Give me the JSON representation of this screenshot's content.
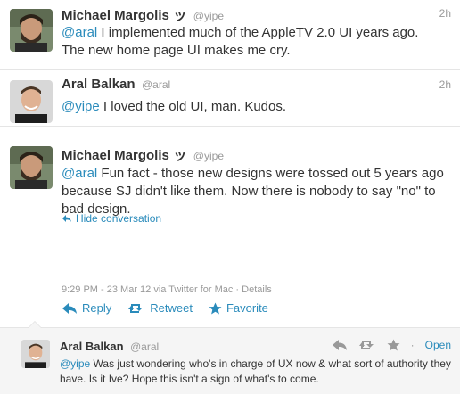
{
  "tweets": [
    {
      "name": "Michael Margolis",
      "badge": "ッ",
      "handle": "@yipe",
      "time": "2h",
      "mention": "@aral",
      "text": " I implemented much of the AppleTV 2.0 UI years ago. The new home page UI makes me cry."
    },
    {
      "name": "Aral Balkan",
      "handle": "@aral",
      "time": "2h",
      "mention": "@yipe",
      "text": " I loved the old UI, man. Kudos."
    },
    {
      "name": "Michael Margolis",
      "badge": "ッ",
      "handle": "@yipe",
      "mention": "@aral",
      "text": " Fun fact - those new designs were tossed out 5 years ago because SJ didn't like them. Now there is nobody to say \"no\" to bad design.",
      "hide_conversation": "Hide conversation",
      "meta": "9:29 PM - 23 Mar 12 via Twitter for Mac · Details",
      "actions": {
        "reply": "Reply",
        "retweet": "Retweet",
        "favorite": "Favorite"
      }
    },
    {
      "name": "Aral Balkan",
      "handle": "@aral",
      "mention": "@yipe",
      "text": " Was just wondering who's in charge of UX now & what sort of authority they have. Is it Ive? Hope this isn't a sign of what's to come.",
      "open": "Open",
      "separator": "·"
    }
  ],
  "colors": {
    "link": "#2a8bbb",
    "muted": "#999999",
    "text": "#333333",
    "accent_icon": "#2a8bbb",
    "inactive_icon": "#999999"
  },
  "icons": [
    "reply-icon",
    "retweet-icon",
    "star-icon",
    "hide-conversation-icon"
  ]
}
